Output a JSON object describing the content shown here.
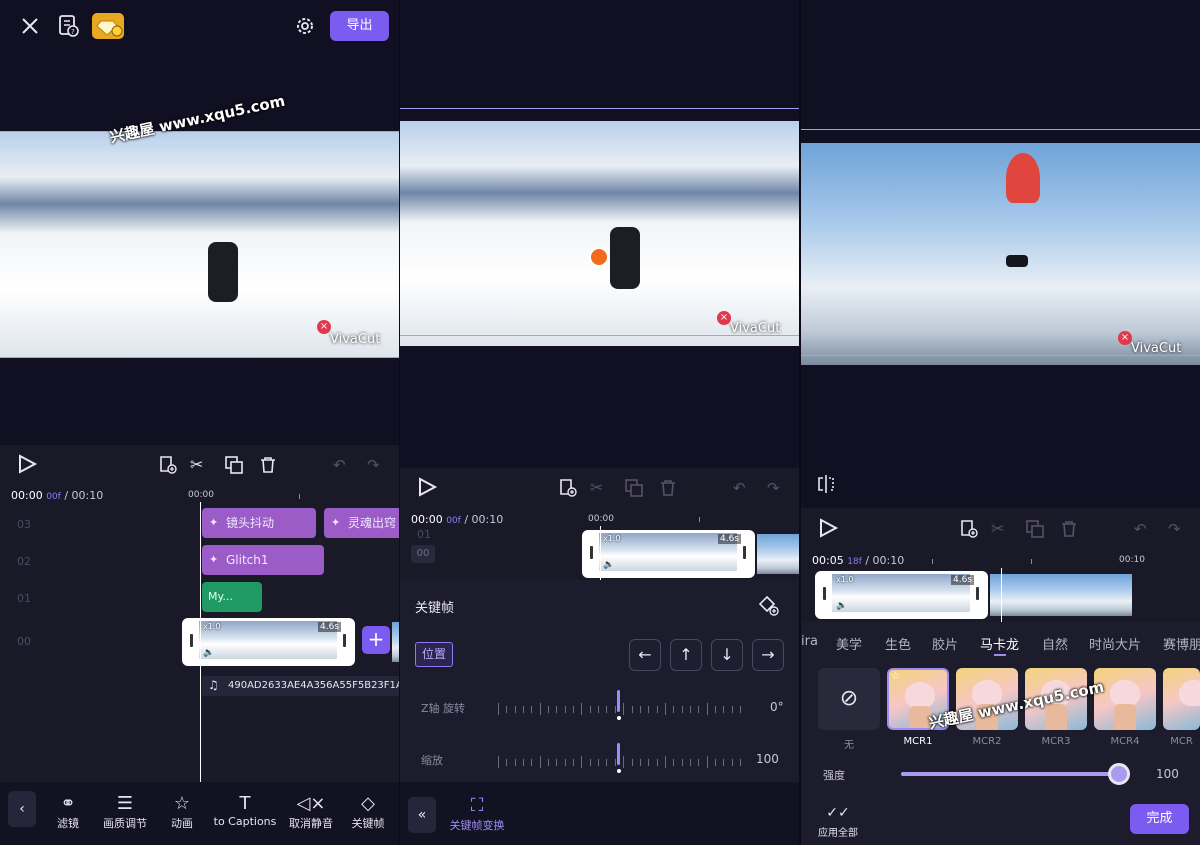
{
  "p1": {
    "export_label": "导出",
    "watermark": "兴趣屋 www.xqu5.com",
    "brand": "VivaCut",
    "time_current": "00:00",
    "time_frame": "00f",
    "time_total": "/ 00:10",
    "ruler_mark": "00:00",
    "tracks": [
      "03",
      "02",
      "01",
      "00"
    ],
    "fx_clips": [
      "镜头抖动",
      "灵魂出窍",
      "Glitch1"
    ],
    "text_clip": "My...",
    "clip_duration": "4.6s",
    "clip_badge": "x1.0",
    "audio_name": "490AD2633AE4A356A55F5B23F1AE1F",
    "tools": [
      {
        "icon": "filter-icon",
        "label": "滤镜"
      },
      {
        "icon": "adjust-icon",
        "label": "画质调节"
      },
      {
        "icon": "animation-icon",
        "label": "动画"
      },
      {
        "icon": "captions-icon",
        "label": "to Captions"
      },
      {
        "icon": "mute-icon",
        "label": "取消静音"
      },
      {
        "icon": "keyframe-icon",
        "label": "关键帧"
      }
    ]
  },
  "p2": {
    "brand": "VivaCut",
    "time_current": "00:00",
    "time_frame": "00f",
    "time_total": "/ 00:10",
    "ruler_mark": "00:00",
    "tracks": [
      "01",
      "00"
    ],
    "clip_duration": "4.6s",
    "clip_badge": "x1.0",
    "panel_title": "关键帧",
    "position_label": "位置",
    "z_rotate_label": "Z轴 旋转",
    "z_rotate_value": "0°",
    "scale_label": "缩放",
    "scale_value": "100",
    "bottom_tab": "关键帧变换"
  },
  "p3": {
    "brand": "VivaCut",
    "watermark": "兴趣屋 www.xqu5.com",
    "time_current": "00:05",
    "time_frame": "18f",
    "time_total": "/ 00:10",
    "ruler_mark": "00:10",
    "clip_duration": "4.6s",
    "clip_badge": "x1.0",
    "categories": [
      "ira",
      "美学",
      "生色",
      "胶片",
      "马卡龙",
      "自然",
      "时尚大片",
      "赛博朋"
    ],
    "active_category_index": 4,
    "filters": [
      "无",
      "MCR1",
      "MCR2",
      "MCR3",
      "MCR4",
      "MCR"
    ],
    "intensity_label": "强度",
    "intensity_value": "100",
    "intensity_fraction": 1.0,
    "apply_all_label": "应用全部",
    "done_label": "完成"
  },
  "colors": {
    "accent": "#7c5cf0",
    "fx_clip": "#9b5cc8",
    "text_clip": "#1f9a63",
    "keyframe_dot": "#f26a1b"
  }
}
